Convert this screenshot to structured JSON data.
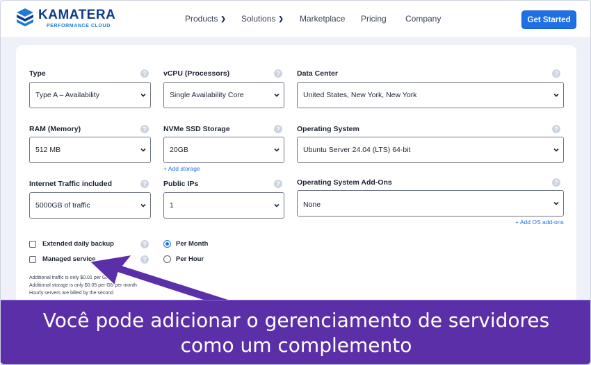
{
  "brand": {
    "name": "KAMATERA",
    "tagline": "PERFORMANCE CLOUD",
    "primary_color": "#0d3b8e",
    "accent_color": "#1f6fe5"
  },
  "nav": {
    "items": [
      {
        "label": "Products",
        "has_dropdown": true
      },
      {
        "label": "Solutions",
        "has_dropdown": true
      },
      {
        "label": "Marketplace",
        "has_dropdown": false
      },
      {
        "label": "Pricing",
        "has_dropdown": false
      },
      {
        "label": "Company",
        "has_dropdown": false
      }
    ],
    "cta_label": "Get Started"
  },
  "config": {
    "type": {
      "label": "Type",
      "value": "Type A – Availability"
    },
    "vcpu": {
      "label": "vCPU (Processors)",
      "value": "Single Availability Core"
    },
    "datacenter": {
      "label": "Data Center",
      "value": "United States, New York, New York"
    },
    "ram": {
      "label": "RAM (Memory)",
      "value": "512 MB"
    },
    "storage": {
      "label": "NVMe SSD Storage",
      "value": "20GB",
      "add_link": "+ Add storage"
    },
    "os": {
      "label": "Operating System",
      "value": "Ubuntu Server 24.04 (LTS) 64-bit"
    },
    "traffic": {
      "label": "Internet Traffic included",
      "value": "5000GB of traffic"
    },
    "public_ips": {
      "label": "Public IPs",
      "value": "1"
    },
    "os_addons": {
      "label": "Operating System Add-Ons",
      "value": "None",
      "add_link": "+ Add OS add-ons"
    }
  },
  "options": {
    "backup": {
      "label": "Extended daily backup",
      "checked": false
    },
    "managed": {
      "label": "Managed service",
      "checked": false
    },
    "billing": [
      {
        "label": "Per Month",
        "selected": true
      },
      {
        "label": "Per Hour",
        "selected": false
      }
    ]
  },
  "notes": [
    "Additional traffic is only $0.01 per GB",
    "Additional storage is only $0.05 per GB per month",
    "Hourly servers are billed by the second"
  ],
  "caption": {
    "line1": "Você pode adicionar o gerenciamento de servidores",
    "line2": "como um complemento",
    "background": "#5b2fa8"
  }
}
